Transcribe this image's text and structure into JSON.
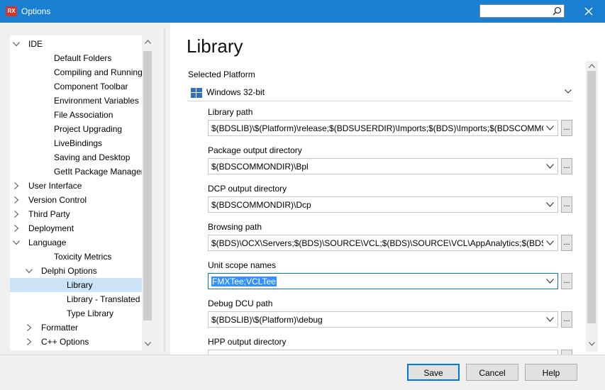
{
  "window": {
    "title": "Options",
    "app_icon_text": "RX",
    "search_value": ""
  },
  "tree": {
    "items": [
      {
        "label": "IDE",
        "level": 0,
        "expander": "expanded",
        "selected": false
      },
      {
        "label": "Default Folders",
        "level": 2,
        "expander": "none",
        "selected": false
      },
      {
        "label": "Compiling and Running",
        "level": 2,
        "expander": "none",
        "selected": false
      },
      {
        "label": "Component Toolbar",
        "level": 2,
        "expander": "none",
        "selected": false
      },
      {
        "label": "Environment Variables",
        "level": 2,
        "expander": "none",
        "selected": false
      },
      {
        "label": "File Association",
        "level": 2,
        "expander": "none",
        "selected": false
      },
      {
        "label": "Project Upgrading",
        "level": 2,
        "expander": "none",
        "selected": false
      },
      {
        "label": "LiveBindings",
        "level": 2,
        "expander": "none",
        "selected": false
      },
      {
        "label": "Saving and Desktop",
        "level": 2,
        "expander": "none",
        "selected": false
      },
      {
        "label": "GetIt Package Manager",
        "level": 2,
        "expander": "none",
        "selected": false
      },
      {
        "label": "User Interface",
        "level": 0,
        "expander": "collapsed",
        "selected": false
      },
      {
        "label": "Version Control",
        "level": 0,
        "expander": "collapsed",
        "selected": false
      },
      {
        "label": "Third Party",
        "level": 0,
        "expander": "collapsed",
        "selected": false
      },
      {
        "label": "Deployment",
        "level": 0,
        "expander": "collapsed",
        "selected": false
      },
      {
        "label": "Language",
        "level": 0,
        "expander": "expanded",
        "selected": false
      },
      {
        "label": "Toxicity Metrics",
        "level": 2,
        "expander": "none",
        "selected": false
      },
      {
        "label": "Delphi Options",
        "level": 1,
        "expander": "expanded",
        "selected": false
      },
      {
        "label": "Library",
        "level": 3,
        "expander": "none",
        "selected": true
      },
      {
        "label": "Library - Translated",
        "level": 3,
        "expander": "none",
        "selected": false
      },
      {
        "label": "Type Library",
        "level": 3,
        "expander": "none",
        "selected": false
      },
      {
        "label": "Formatter",
        "level": 1,
        "expander": "collapsed",
        "selected": false
      },
      {
        "label": "C++ Options",
        "level": 1,
        "expander": "collapsed",
        "selected": false
      }
    ]
  },
  "page": {
    "title": "Library",
    "platform_label": "Selected Platform",
    "platform_value": "Windows 32-bit",
    "fields": [
      {
        "label": "Library path",
        "value": "$(BDSLIB)\\$(Platform)\\release;$(BDSUSERDIR)\\Imports;$(BDS)\\Imports;$(BDSCOMMONDIR)\\Dcp\\$(Platform)",
        "focused": false
      },
      {
        "label": "Package output directory",
        "value": "$(BDSCOMMONDIR)\\Bpl",
        "focused": false
      },
      {
        "label": "DCP output directory",
        "value": "$(BDSCOMMONDIR)\\Dcp",
        "focused": false
      },
      {
        "label": "Browsing path",
        "value": "$(BDS)\\OCX\\Servers;$(BDS)\\SOURCE\\VCL;$(BDS)\\SOURCE\\VCL\\AppAnalytics;$(BDS)\\source\\rtl\\common",
        "focused": false
      },
      {
        "label": "Unit scope names",
        "value": "FMXTee;VCLTee",
        "focused": true
      },
      {
        "label": "Debug DCU path",
        "value": "$(BDSLIB)\\$(Platform)\\debug",
        "focused": false
      },
      {
        "label": "HPP output directory",
        "value": "",
        "focused": false
      }
    ],
    "browse_button_label": "..."
  },
  "buttons": {
    "save": "Save",
    "cancel": "Cancel",
    "help": "Help"
  },
  "colors": {
    "titlebar": "#1a7fd1",
    "selection": "#cce4f7",
    "accent": "#0078d7"
  }
}
